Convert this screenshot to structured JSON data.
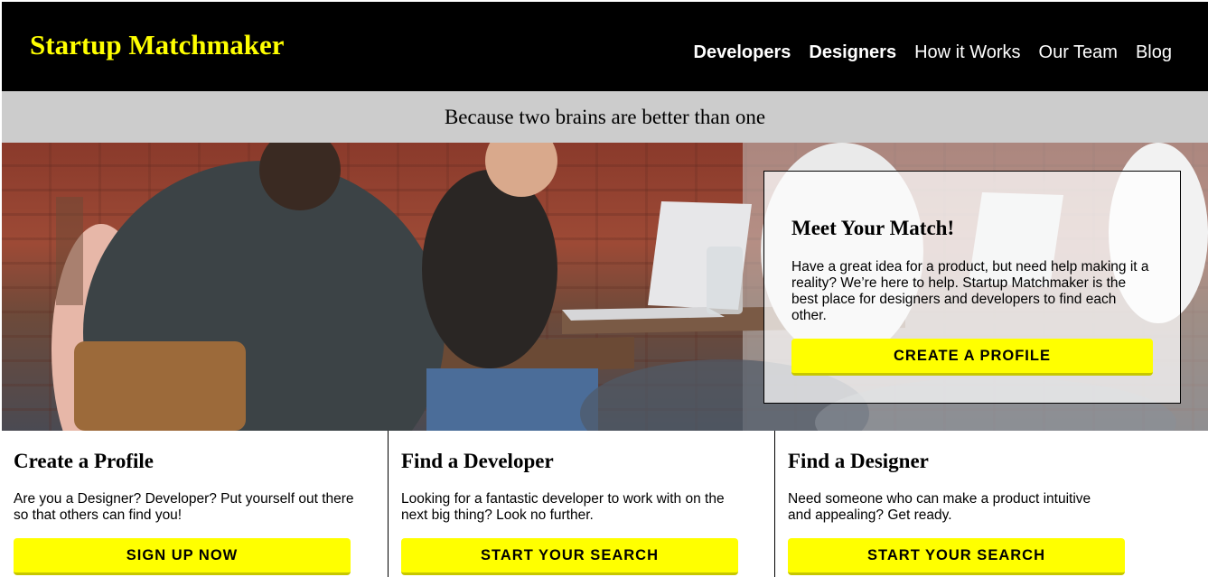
{
  "header": {
    "brand": "Startup Matchmaker",
    "nav": [
      {
        "label": "Developers"
      },
      {
        "label": "Designers"
      },
      {
        "label": "How it Works"
      },
      {
        "label": "Our Team"
      },
      {
        "label": "Blog"
      }
    ]
  },
  "tagline": "Because two brains are better than one",
  "hero": {
    "card": {
      "title": "Meet Your Match!",
      "text": "Have a great idea for a product, but need help making it a reality? We’re here to help. Startup Matchmaker is the best place for designers and developers to find each other.",
      "button": "CREATE A PROFILE"
    }
  },
  "features": [
    {
      "title": "Create a Profile",
      "text": "Are you a Designer? Developer? Put yourself out there so that others can find you!",
      "button": "SIGN UP NOW"
    },
    {
      "title": "Find a Developer",
      "text": "Looking for a fantastic developer to work with on the next big thing? Look no further.",
      "button": "START YOUR SEARCH"
    },
    {
      "title": "Find a Designer",
      "text": "Need someone who can make a product intuitive and appealing? Get ready.",
      "button": "START YOUR SEARCH"
    }
  ],
  "colors": {
    "header_bg": "#000000",
    "brand": "#ffff00",
    "tagline_bg": "#cccccc",
    "button": "#ffff00"
  }
}
